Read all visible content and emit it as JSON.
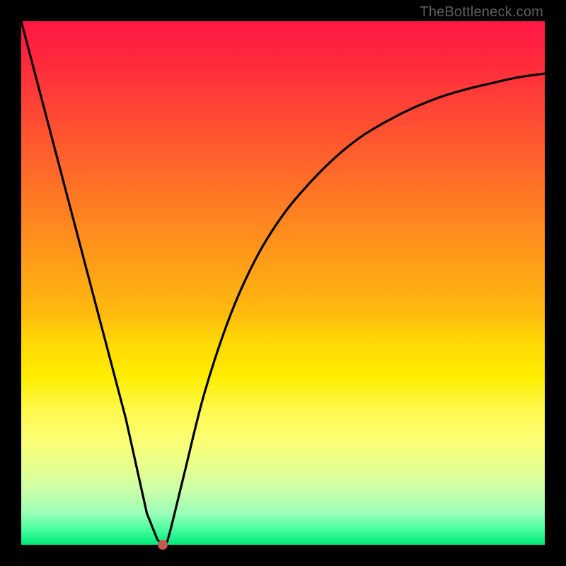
{
  "watermark": "TheBottleneck.com",
  "chart_data": {
    "type": "line",
    "title": "",
    "xlabel": "",
    "ylabel": "",
    "xlim": [
      0,
      100
    ],
    "ylim": [
      0,
      100
    ],
    "series": [
      {
        "name": "bottleneck-curve",
        "x": [
          0,
          5,
          10,
          15,
          20,
          24,
          26,
          27,
          28,
          31,
          35,
          40,
          45,
          50,
          55,
          60,
          65,
          70,
          75,
          80,
          85,
          90,
          95,
          100
        ],
        "values": [
          100,
          81,
          62,
          43,
          24,
          6,
          1,
          0,
          1,
          13,
          29,
          44,
          55,
          63,
          69,
          74,
          78,
          81,
          83.5,
          85.5,
          87,
          88.2,
          89.3,
          90
        ]
      }
    ],
    "annotations": [
      {
        "name": "min-marker",
        "x": 27,
        "y": 0,
        "color": "#c25b4e"
      }
    ],
    "grid": false,
    "legend": null
  },
  "colors": {
    "curve": "#000000",
    "marker": "#c25b4e",
    "frame": "#000000"
  }
}
